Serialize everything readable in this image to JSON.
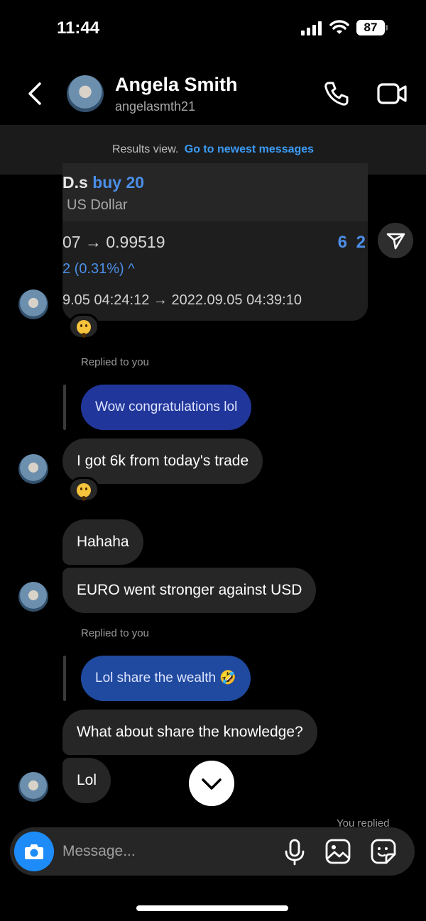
{
  "status_bar": {
    "time": "11:44",
    "battery": "87"
  },
  "header": {
    "name": "Angela Smith",
    "handle": "angelasmth21",
    "icons": {
      "back": "chevron-left-icon",
      "call": "phone-icon",
      "video": "video-camera-icon"
    }
  },
  "banner": {
    "text": "Results view.",
    "link": "Go to newest messages"
  },
  "trade_card": {
    "symbol": "D.s",
    "action": "buy 20",
    "currency": "US Dollar",
    "price": "07 → 0.99519",
    "profit": "6 2",
    "change": "2 (0.31%) ^",
    "dates": "9.05 04:24:12 → 2022.09.05 04:39:10"
  },
  "messages": {
    "reply_label_1": "Replied to you",
    "quoted_1": "Wow congratulations lol",
    "msg_1": "I got 6k from today's trade",
    "msg_2": "Hahaha",
    "msg_3": "EURO went stronger against USD",
    "reply_label_2": "Replied to you",
    "quoted_2": "Lol share the wealth 🤣",
    "msg_4": "What about share the knowledge?",
    "msg_5": "Lol",
    "you_replied": "You replied"
  },
  "composer": {
    "placeholder": "Message..."
  },
  "colors": {
    "accent_blue": "#3b9bf5",
    "camera_blue": "#1d8cf8",
    "bubble_in": "#262626",
    "bubble_quoted": "#20369a"
  }
}
